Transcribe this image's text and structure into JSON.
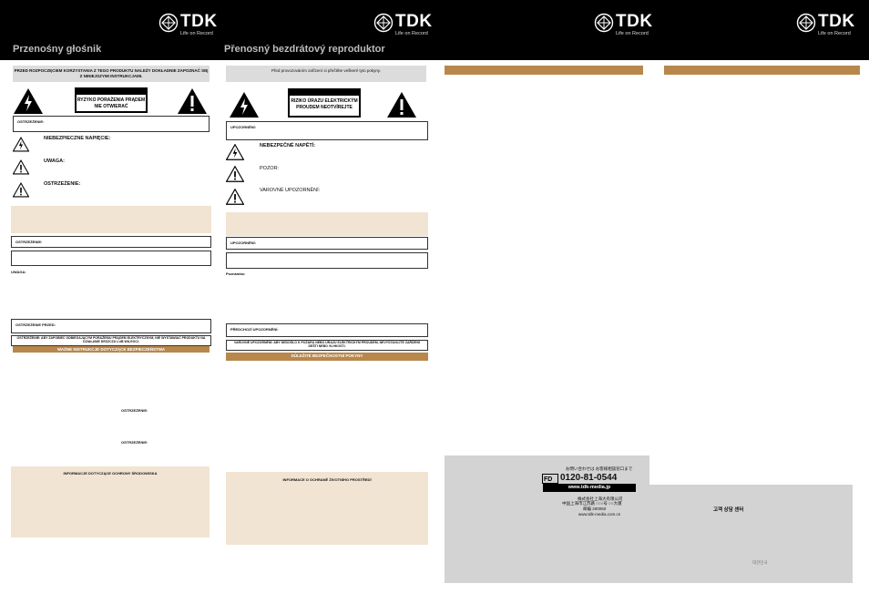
{
  "brand": {
    "name": "TDK",
    "tagline": "Life on Record"
  },
  "polish": {
    "title": "Przenośny głośnik",
    "gray_header": "PRZED ROZPOCZĘCIEM KORZYSTANIA Z TEGO PRODUKTU NALEŻY DOKŁADNIE ZAPOZNAĆ SIĘ Z NINIEJSZYMI INSTRUKCJAMI.",
    "shock_warning": "RYZYKO PORAŻENIA PRĄDEM NIE OTWIERAĆ",
    "ostrzezenie_box": "OSTRZEŻENIE:",
    "label_voltage": "NIEBEZPIECZNE NAPIĘCIE:",
    "label_caution": "UWAGA:",
    "label_warning": "OSTRZEŻENIE:",
    "box_warning2": "OSTRZEŻENIE:",
    "uwaga_para": "UWAGA:",
    "box_prev_warning": "OSTRZEŻENIE PRZED:",
    "box_long": "OSTRZEŻENIE: ABY ZAPOBIEC ODBIEGAJĄCYM PORAŻENIU PRĄDEM ELEKTRYCZNYM, NIE WYSTAWIAĆ PRODUKTU NA DZIAŁANIE DESZCZU LUB WILGOCI.",
    "bar_safety": "WAŻNE INSTRUKCJE DOTYCZĄCE BEZPIECZEŃSTWA",
    "inline_1": "OSTRZEŻENIE:",
    "inline_2": "OSTRZEŻENIE:",
    "beige_bottom": "INFORMACJE DOTYCZĄCE OCHRONY ŚRODOWISKA"
  },
  "czech": {
    "title": "Přenosný bezdrátový reproduktor",
    "gray_header": "Před provozováním zařízení si přečtěte veškeré tyto pokyny.",
    "shock_warning": "RIZIKO ÚRAZU ELEKTRICKÝM PROUDEM NEOTVÍREJTE",
    "upozorneni_box": "UPOZORNĚNÍ:",
    "label_voltage": "NEBEZPEČNÉ NAPĚTÍ:",
    "label_caution": "POZOR:",
    "label_warning": "VAROVNÉ UPOZORNĚNÍ:",
    "box_warning2": "UPOZORNĚNÍ:",
    "poznamka": "Poznámka:",
    "box_prev_warning": "PŘEDCHOZÍ UPOZORNĚNÍ:",
    "box_long": "VAROVNÉ UPOZORNĚNÍ: ABY NEDOŠLO K POŽÁRU NEBO ÚRAZU ELEKTRICKÝM PROUDEM, NEVYSTAVUJTE ZAŘÍZENÍ DEŠTI NEBO VLHKOSTI.",
    "bar_safety": "DŮLEŽITÉ BEZPEČNOSTNÍ POKYNY",
    "beige_bottom": "INFORMACE O OCHRANĚ ŽIVOTNÍHO PROSTŘEDÍ"
  },
  "japan": {
    "line1": "お問い合わせは お客様相談窓口まで",
    "free_dial": "0120-81-0544",
    "web": "www.tdk-media.jp",
    "co1": "株式会社上海大有限公司",
    "co2": "中国上海市江苏路 ○○○号 ○○大厦",
    "co3": "邮编 200050",
    "web2": "www.tdk-media.com.cn"
  },
  "korea": {
    "text1": "고객 상담 센터",
    "text2": "대한민국"
  }
}
